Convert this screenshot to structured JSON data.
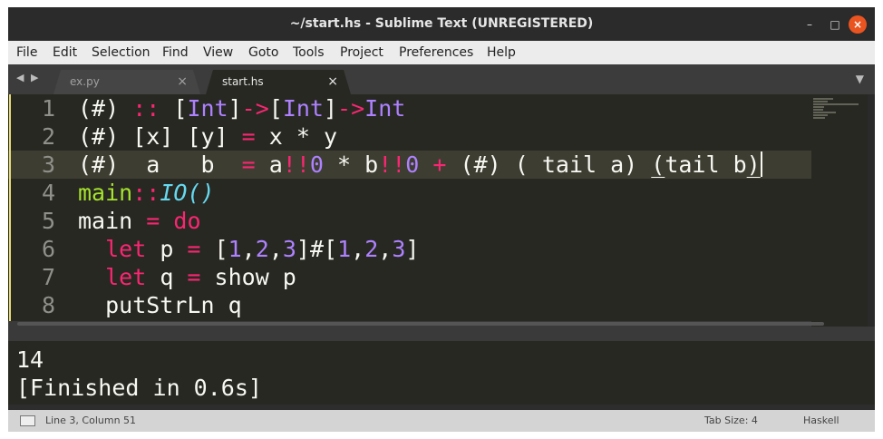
{
  "window": {
    "title": "~/start.hs - Sublime Text (UNREGISTERED)",
    "controls": [
      "–",
      "□",
      "×"
    ]
  },
  "menu": [
    "File",
    "Edit",
    "Selection",
    "Find",
    "View",
    "Goto",
    "Tools",
    "Project",
    "Preferences",
    "Help"
  ],
  "tabs": [
    {
      "label": "ex.py",
      "active": false,
      "close": "×"
    },
    {
      "label": "start.hs",
      "active": true,
      "close": "×"
    }
  ],
  "tab_nav_icon": "◀ ▶",
  "tab_dropdown_icon": "▼",
  "editor": {
    "active_line": 3,
    "lines": [
      {
        "n": "1",
        "tokens": [
          [
            "(#) ",
            "plain"
          ],
          [
            "::",
            "keyword"
          ],
          [
            " [",
            "plain"
          ],
          [
            "Int",
            "type"
          ],
          [
            "]",
            "plain"
          ],
          [
            "->",
            "keyword"
          ],
          [
            "[",
            "plain"
          ],
          [
            "Int",
            "type"
          ],
          [
            "]",
            "plain"
          ],
          [
            "->",
            "keyword"
          ],
          [
            "Int",
            "type"
          ]
        ]
      },
      {
        "n": "2",
        "tokens": [
          [
            "(#) [x] [y] ",
            "plain"
          ],
          [
            "=",
            "keyword"
          ],
          [
            " x * y",
            "plain"
          ]
        ]
      },
      {
        "n": "3",
        "tokens": [
          [
            "(#)  a   b  ",
            "plain"
          ],
          [
            "=",
            "keyword"
          ],
          [
            " a",
            "plain"
          ],
          [
            "!!",
            "keyword"
          ],
          [
            "0",
            "number"
          ],
          [
            " * b",
            "plain"
          ],
          [
            "!!",
            "keyword"
          ],
          [
            "0",
            "number"
          ],
          [
            " ",
            "plain"
          ],
          [
            "+",
            "keyword"
          ],
          [
            " (#) ( tail a) ",
            "plain"
          ],
          [
            "(",
            "underline"
          ],
          [
            "tail b",
            "plain"
          ],
          [
            ")",
            "underline"
          ]
        ]
      },
      {
        "n": "4",
        "tokens": [
          [
            "main",
            "function"
          ],
          [
            "::",
            "keyword"
          ],
          [
            "IO",
            "italic-type"
          ],
          [
            "()",
            "italic-type"
          ]
        ]
      },
      {
        "n": "5",
        "tokens": [
          [
            "main ",
            "plain"
          ],
          [
            "=",
            "keyword"
          ],
          [
            " ",
            "plain"
          ],
          [
            "do",
            "keyword"
          ]
        ]
      },
      {
        "n": "6",
        "tokens": [
          [
            "  ",
            "plain"
          ],
          [
            "let",
            "keyword"
          ],
          [
            " p ",
            "plain"
          ],
          [
            "=",
            "keyword"
          ],
          [
            " [",
            "plain"
          ],
          [
            "1",
            "number"
          ],
          [
            ",",
            "plain"
          ],
          [
            "2",
            "number"
          ],
          [
            ",",
            "plain"
          ],
          [
            "3",
            "number"
          ],
          [
            "]#[",
            "plain"
          ],
          [
            "1",
            "number"
          ],
          [
            ",",
            "plain"
          ],
          [
            "2",
            "number"
          ],
          [
            ",",
            "plain"
          ],
          [
            "3",
            "number"
          ],
          [
            "]",
            "plain"
          ]
        ]
      },
      {
        "n": "7",
        "tokens": [
          [
            "  ",
            "plain"
          ],
          [
            "let",
            "keyword"
          ],
          [
            " q ",
            "plain"
          ],
          [
            "=",
            "keyword"
          ],
          [
            " show p",
            "plain"
          ]
        ]
      },
      {
        "n": "8",
        "tokens": [
          [
            "  putStrLn q",
            "plain"
          ]
        ]
      }
    ]
  },
  "output": {
    "lines": [
      "14",
      "[Finished in 0.6s]"
    ]
  },
  "status": {
    "position": "Line 3, Column 51",
    "tab_size": "Tab Size: 4",
    "syntax": "Haskell"
  },
  "colors": {
    "editor_bg": "#272822",
    "keyword": "#f92672",
    "type": "#ae81ff",
    "function": "#a6e22e",
    "italic_type": "#66d9ef",
    "close_button": "#e95420"
  }
}
